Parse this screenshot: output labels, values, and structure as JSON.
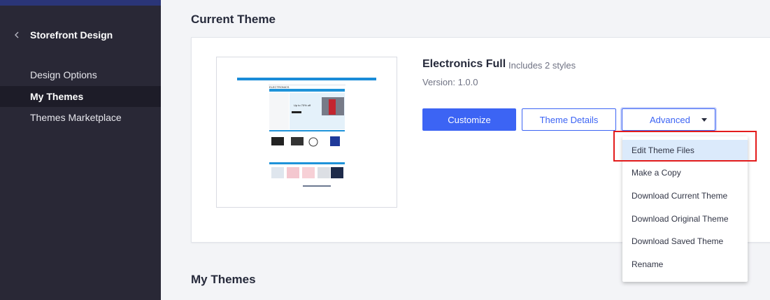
{
  "sidebar": {
    "title": "Storefront Design",
    "items": [
      {
        "label": "Design Options",
        "active": false
      },
      {
        "label": "My Themes",
        "active": true
      },
      {
        "label": "Themes Marketplace",
        "active": false
      }
    ]
  },
  "main": {
    "current_theme_heading": "Current Theme",
    "my_themes_heading": "My Themes",
    "theme": {
      "name": "Electronics Full",
      "styles": "Includes 2 styles",
      "version": "Version: 1.0.0",
      "thumbnail_logo": "ELECTRONICS",
      "thumbnail_promo": "Up to 70% off"
    },
    "buttons": {
      "customize": "Customize",
      "theme_details": "Theme Details",
      "advanced": "Advanced"
    },
    "advanced_menu": [
      "Edit Theme Files",
      "Make a Copy",
      "Download Current Theme",
      "Download Original Theme",
      "Download Saved Theme",
      "Rename"
    ]
  },
  "colors": {
    "sidebar_bg": "#292836",
    "accent": "#3c64f4",
    "highlight": "#e31b1b",
    "menu_hover": "#dbeafb"
  }
}
